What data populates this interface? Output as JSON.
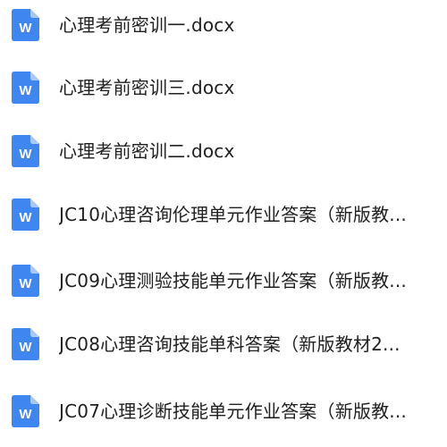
{
  "files": [
    {
      "name": "心理考前密训一.docx",
      "icon": "word-doc-icon"
    },
    {
      "name": "心理考前密训三.docx",
      "icon": "word-doc-icon"
    },
    {
      "name": "心理考前密训二.docx",
      "icon": "word-doc-icon"
    },
    {
      "name": "JC10心理咨询伦理单元作业答案（新版教...",
      "icon": "word-doc-icon"
    },
    {
      "name": "JC09心理测验技能单元作业答案（新版教...",
      "icon": "word-doc-icon"
    },
    {
      "name": "JC08心理咨询技能单科答案（新版教材2...",
      "icon": "word-doc-icon"
    },
    {
      "name": "JC07心理诊断技能单元作业答案（新版教...",
      "icon": "word-doc-icon"
    }
  ],
  "icon_glyph": "W",
  "colors": {
    "icon_blue": "#3f86f0",
    "icon_fold": "#a9c8f8",
    "text": "#202020",
    "background": "#ffffff"
  }
}
